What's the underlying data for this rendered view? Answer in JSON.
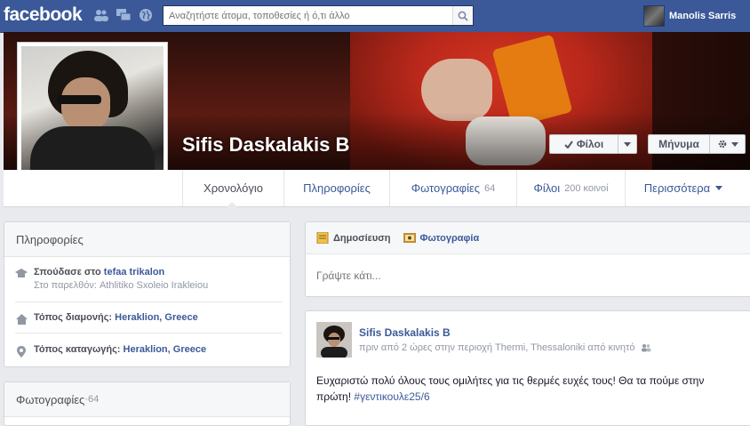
{
  "header": {
    "logo": "facebook",
    "search_placeholder": "Αναζητήστε άτομα, τοποθεσίες ή ό,τι άλλο",
    "user_name": "Manolis Sarris"
  },
  "profile": {
    "name": "Sifis Daskalakis B",
    "friends_button": "Φίλοι",
    "message_button": "Μήνυμα"
  },
  "tabs": [
    {
      "label": "Χρονολόγιο",
      "count": ""
    },
    {
      "label": "Πληροφορίες",
      "count": ""
    },
    {
      "label": "Φωτογραφίες",
      "count": "64"
    },
    {
      "label": "Φίλοι",
      "count": "200 κοινοί"
    },
    {
      "label": "Περισσότερα",
      "count": ""
    }
  ],
  "about": {
    "title": "Πληροφορίες",
    "studied_prefix": "Σπούδασε στο ",
    "studied_place": "tefaa trikalon",
    "studied_past": "Στο παρελθόν: Athlitiko Sxoleio Irakleiou",
    "lives_prefix": "Τόπος διαμονής: ",
    "lives_place": "Heraklion, Greece",
    "from_prefix": "Τόπος καταγωγής: ",
    "from_place": "Heraklion, Greece"
  },
  "photos_box": {
    "title": "Φωτογραφίες",
    "sep": " · ",
    "count": "64"
  },
  "composer": {
    "status_tab": "Δημοσίευση",
    "photo_tab": "Φωτογραφία",
    "placeholder": "Γράψτε κάτι..."
  },
  "post": {
    "author": "Sifis Daskalakis B",
    "meta": "πριν από 2 ώρες στην περιοχή Thermi, Thessaloniki από κινητό",
    "text": "Ευχαριστώ πολύ όλους τους ομιλήτες για τις θερμές ευχές τους! Θα τα πούμε στην πρώτη! ",
    "hashtag": "#γεντικουλε25/6"
  },
  "colors": {
    "brand": "#3b5998",
    "background": "#e9eaed",
    "link": "#3b5998",
    "muted": "#9197a3"
  }
}
